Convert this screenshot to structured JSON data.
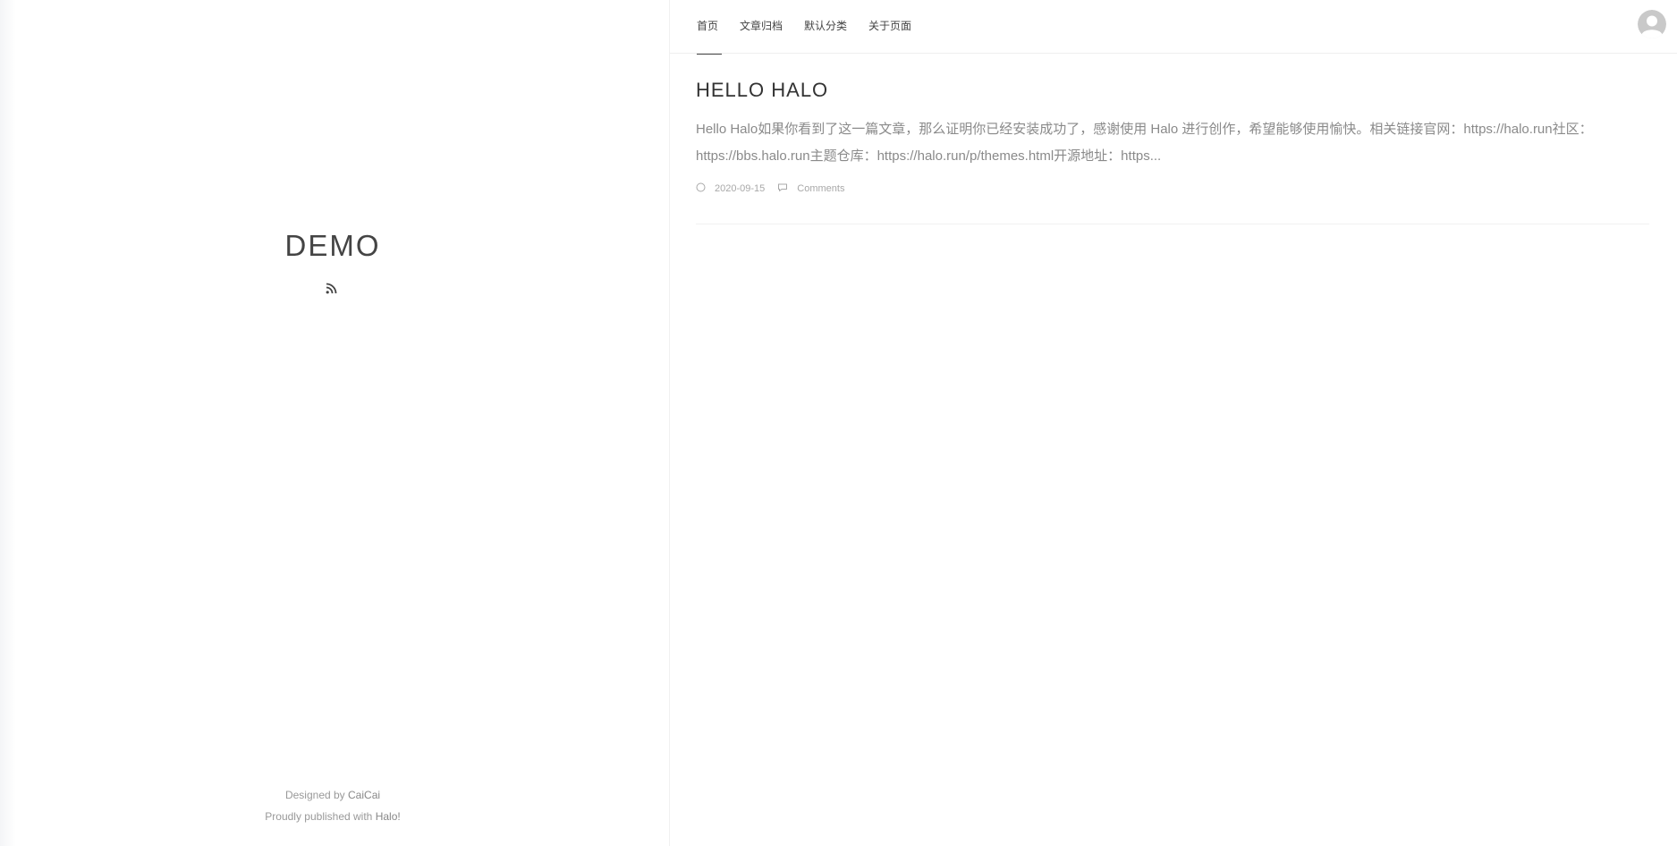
{
  "site": {
    "title": "DEMO",
    "rss_icon": "rss-icon"
  },
  "footer": {
    "designed_prefix": "Designed by ",
    "designer": "CaiCai",
    "published_prefix": "Proudly published with ",
    "platform": "Halo!"
  },
  "nav": {
    "items": [
      {
        "label": "首页",
        "active": true
      },
      {
        "label": "文章归档",
        "active": false
      },
      {
        "label": "默认分类",
        "active": false
      },
      {
        "label": "关于页面",
        "active": false
      }
    ],
    "avatar_icon": "user-avatar-icon"
  },
  "post": {
    "title": "HELLO HALO",
    "excerpt": "Hello Halo如果你看到了这一篇文章，那么证明你已经安装成功了，感谢使用 Halo 进行创作，希望能够使用愉快。相关链接官网：https://halo.run社区：https://bbs.halo.run主题仓库：https://halo.run/p/themes.html开源地址：https...",
    "date": "2020-09-15",
    "comments_label": "Comments",
    "date_icon": "clock-icon",
    "comments_icon": "comment-icon"
  },
  "colors": {
    "text_dark": "#444444",
    "text_muted": "#8a8a8a",
    "meta": "#a8a8a8",
    "divider": "#f0f0f0"
  }
}
